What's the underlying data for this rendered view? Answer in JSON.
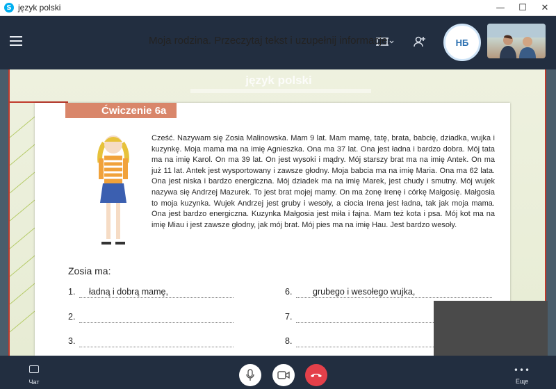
{
  "window": {
    "title": "język polski",
    "app_icon": "S",
    "minimize": "—",
    "maximize": "☐",
    "close": "✕"
  },
  "callbar": {
    "avatar_initials": "НБ",
    "icons": [
      "menu-icon",
      "layout-icon",
      "add-person-icon"
    ]
  },
  "slide": {
    "title": "język polski",
    "exercise_label": "Ćwiczenie 6a",
    "exercise_title": "Moja rodzina. Przeczytaj tekst i uzupełnij informacje.",
    "reading": "Cześć. Nazywam się Zosia Malinowska. Mam 9 lat. Mam mamę, tatę, brata, babcię, dziadka, wujka i kuzynkę. Moja mama ma na imię Agnieszka. Ona ma 37 lat. Ona jest ładna i bardzo dobra. Mój tata ma na imię Karol. On ma 39 lat. On jest wysoki i mądry. Mój starszy brat ma na imię Antek. On ma już 11 lat. Antek jest wysportowany i zawsze głodny. Moja babcia ma na imię Maria. Ona ma 62 lata. Ona jest niska i bardzo energiczna. Mój dziadek ma na imię Marek, jest chudy i smutny. Mój wujek nazywa się Andrzej Mazurek. To jest brat mojej mamy. On ma żonę Irenę i córkę Małgosię. Małgosia to moja kuzynka. Wujek Andrzej jest gruby i wesoły, a ciocia Irena jest ładna, tak jak moja mama. Ona jest bardzo energiczna. Kuzynka Małgosia jest miła i fajna. Mam też kota i psa. Mój kot ma na imię Miau i jest zawsze głodny, jak mój brat. Mój pies ma na imię Hau. Jest bardzo wesoły.",
    "zosia_ma": "Zosia ma:",
    "rows": [
      {
        "num": "1.",
        "answer": "ładną i dobrą mamę,"
      },
      {
        "num": "2.",
        "answer": ""
      },
      {
        "num": "3.",
        "answer": ""
      },
      {
        "num": "6.",
        "answer": "grubego i wesołego wujka,"
      },
      {
        "num": "7.",
        "answer": ""
      },
      {
        "num": "8.",
        "answer": ""
      }
    ]
  },
  "bottombar": {
    "chat_label": "Чат",
    "more_label": "Еще",
    "more_glyph": "•••"
  }
}
